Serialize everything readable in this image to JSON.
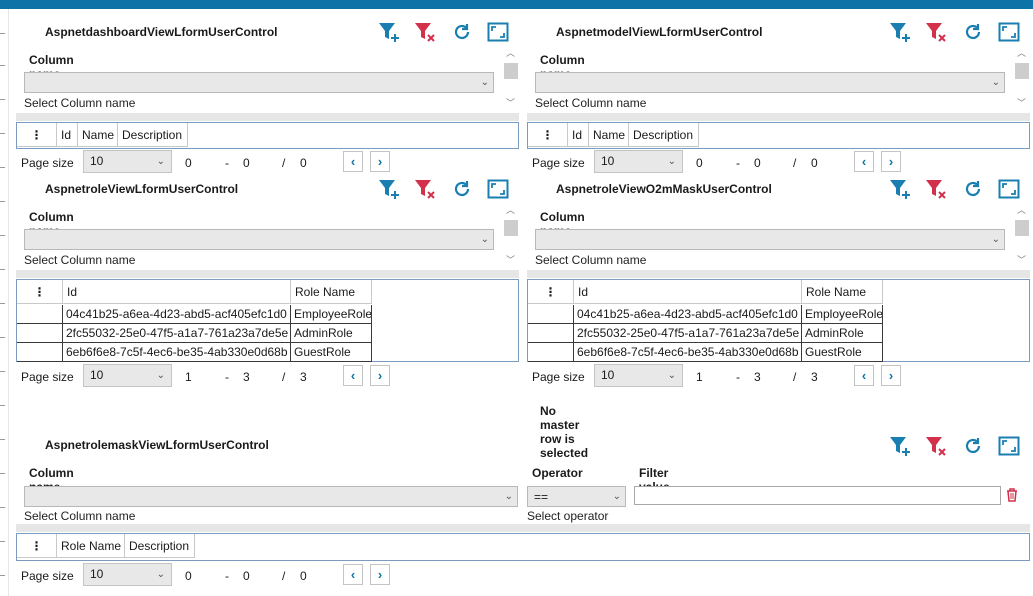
{
  "colors": {
    "accent": "#0e74a8",
    "filter_add": "#1a7fb0",
    "filter_clear": "#d2304b",
    "grid_border": "#7a9cc0"
  },
  "common": {
    "column_name_label": "Column name",
    "select_column_hint": "Select Column name",
    "page_size_label": "Page size",
    "page_size_value": "10",
    "grid_menu_glyph": "⋮",
    "prev_glyph": "‹",
    "next_glyph": "›",
    "dash": "-",
    "slash": "/",
    "icons": [
      "filter-add-icon",
      "filter-clear-icon",
      "refresh-icon",
      "maximize-icon"
    ]
  },
  "panels": {
    "dashboard": {
      "title": "AspnetdashboardViewLformUserControl",
      "columns": [
        "Id",
        "Name",
        "Description"
      ],
      "pager": {
        "from": "0",
        "to": "0",
        "total": "0"
      }
    },
    "model": {
      "title": "AspnetmodelViewLformUserControl",
      "columns": [
        "Id",
        "Name",
        "Description"
      ],
      "pager": {
        "from": "0",
        "to": "0",
        "total": "0"
      }
    },
    "role": {
      "title": "AspnetroleViewLformUserControl",
      "columns": [
        "Id",
        "Role Name"
      ],
      "rows": [
        {
          "id": "04c41b25-a6ea-4d23-abd5-acf405efc1d0",
          "role": "EmployeeRole"
        },
        {
          "id": "2fc55032-25e0-47f5-a1a7-761a23a7de5e",
          "role": "AdminRole"
        },
        {
          "id": "6eb6f6e8-7c5f-4ec6-be35-4ab330e0d68b",
          "role": "GuestRole"
        }
      ],
      "pager": {
        "from": "1",
        "to": "3",
        "total": "3"
      }
    },
    "role_o2m": {
      "title": "AspnetroleViewO2mMaskUserControl",
      "columns": [
        "Id",
        "Role Name"
      ],
      "rows": [
        {
          "id": "04c41b25-a6ea-4d23-abd5-acf405efc1d0",
          "role": "EmployeeRole"
        },
        {
          "id": "2fc55032-25e0-47f5-a1a7-761a23a7de5e",
          "role": "AdminRole"
        },
        {
          "id": "6eb6f6e8-7c5f-4ec6-be35-4ab330e0d68b",
          "role": "GuestRole"
        }
      ],
      "pager": {
        "from": "1",
        "to": "3",
        "total": "3"
      },
      "status_message": "No master row is selected"
    },
    "rolemask": {
      "title": "AspnetrolemaskViewLformUserControl",
      "operator_label": "Operator",
      "operator_value": "==",
      "operator_hint": "Select operator",
      "filter_value_label": "Filter value",
      "filter_value": "",
      "columns": [
        "Role Name",
        "Description"
      ],
      "pager": {
        "from": "0",
        "to": "0",
        "total": "0"
      }
    }
  }
}
